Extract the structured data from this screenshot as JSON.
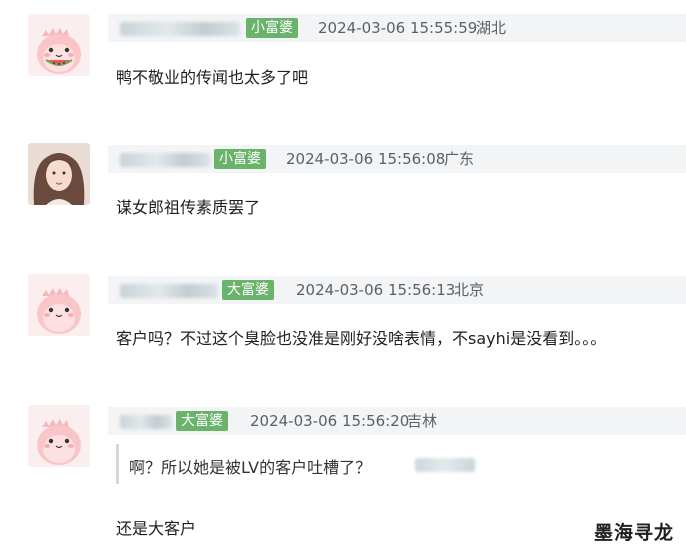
{
  "comments": [
    {
      "badge": "小富婆",
      "timestamp": "2024-03-06 15:55:59",
      "location": "湖北",
      "text": "鸭不敬业的传闻也太多了吧"
    },
    {
      "badge": "小富婆",
      "timestamp": "2024-03-06 15:56:08",
      "location": "广东",
      "text": "谋女郎祖传素质罢了"
    },
    {
      "badge": "大富婆",
      "timestamp": "2024-03-06 15:56:13",
      "location": "北京",
      "text": "客户吗？不过这个臭脸也没准是刚好没啥表情，不sayhi是没看到。。。"
    },
    {
      "badge": "大富婆",
      "timestamp": "2024-03-06 15:56:20",
      "location": "吉林",
      "quote": "啊？所以她是被LV的客户吐槽了？",
      "text": "还是大客户"
    }
  ],
  "watermark": "墨海寻龙",
  "colors": {
    "badge": "#69b36b",
    "header_bar": "#f2f4f5",
    "meta_text": "#5a6166"
  },
  "icons": {
    "avatar_1": "pink-dinosaur-eating-watermelon",
    "avatar_2": "woman-portrait-photo",
    "avatar_3": "pink-dinosaur",
    "avatar_4": "pink-dinosaur"
  }
}
